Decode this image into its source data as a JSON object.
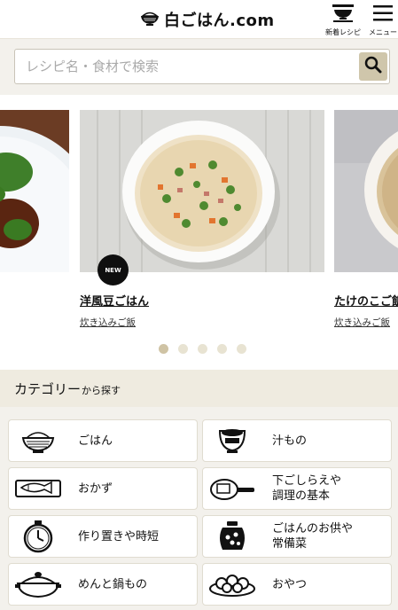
{
  "header": {
    "logo_text": "白ごはん.com",
    "new_recipes_label": "新着レシピ",
    "menu_label": "メニュー"
  },
  "search": {
    "placeholder": "レシピ名・食材で検索"
  },
  "carousel": {
    "slides": [
      {
        "title": "洋風豆ごはん",
        "category": "炊き込みご飯",
        "badge": "NEW"
      },
      {
        "title": "たけのこご飯",
        "category": "炊き込みご飯"
      }
    ],
    "dot_count": 5,
    "active_dot": 0
  },
  "categories": {
    "title": "カテゴリー",
    "title_suffix": "から探す",
    "items": [
      {
        "label": "ごはん",
        "icon": "rice-bowl-icon"
      },
      {
        "label": "汁もの",
        "icon": "soup-bowl-icon"
      },
      {
        "label": "おかず",
        "icon": "fish-plate-icon"
      },
      {
        "label": "下ごしらえや\n調理の基本",
        "icon": "frying-pan-icon"
      },
      {
        "label": "作り置きや時短",
        "icon": "stopwatch-icon"
      },
      {
        "label": "ごはんのお供や\n常備菜",
        "icon": "pickle-jar-icon"
      },
      {
        "label": "めんと鍋もの",
        "icon": "clay-pot-icon"
      },
      {
        "label": "おやつ",
        "icon": "dango-icon"
      }
    ]
  }
}
